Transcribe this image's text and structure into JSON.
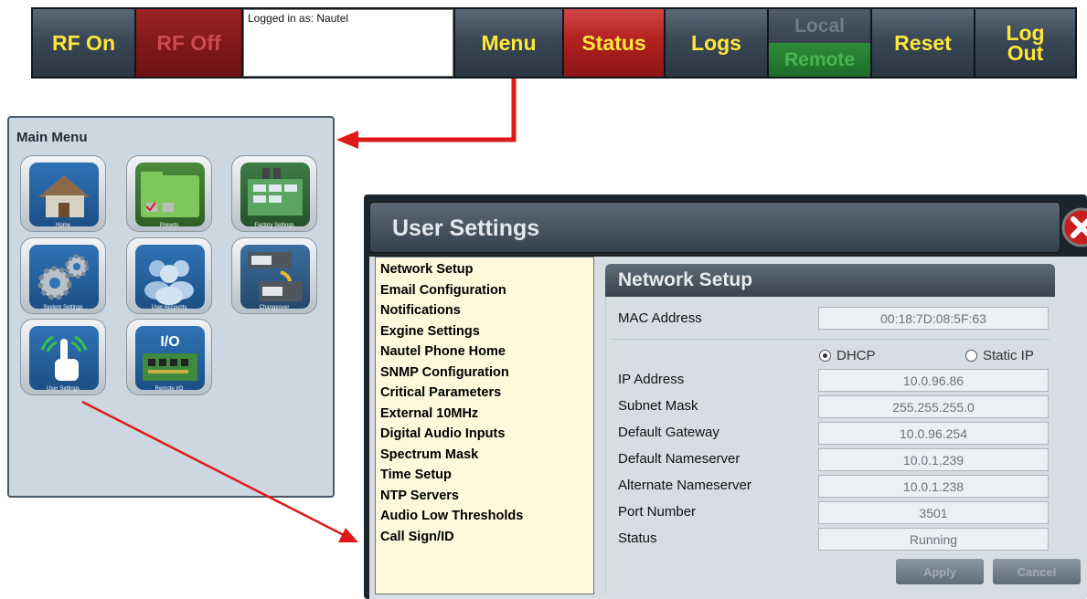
{
  "toolbar": {
    "rf_on": "RF On",
    "rf_off": "RF Off",
    "login_text": "Logged in as: Nautel",
    "menu": "Menu",
    "status": "Status",
    "logs": "Logs",
    "local": "Local",
    "remote": "Remote",
    "reset": "Reset",
    "logout_line1": "Log",
    "logout_line2": "Out"
  },
  "main_menu": {
    "title": "Main Menu",
    "items": [
      {
        "label": "Home",
        "icon": "home-icon"
      },
      {
        "label": "Presets",
        "icon": "presets-folder-icon"
      },
      {
        "label": "Factory Settings",
        "icon": "factory-icon"
      },
      {
        "label": "System Settings",
        "icon": "gears-icon"
      },
      {
        "label": "User Accounts",
        "icon": "users-icon"
      },
      {
        "label": "Changeover",
        "icon": "changeover-icon"
      },
      {
        "label": "User Settings",
        "icon": "touch-settings-icon"
      },
      {
        "label": "Remote I/O",
        "icon": "remote-io-icon"
      }
    ]
  },
  "user_settings": {
    "title": "User Settings",
    "menu_items": [
      "Network Setup",
      "Email Configuration",
      "Notifications",
      "Exgine Settings",
      "Nautel Phone Home",
      "SNMP Configuration",
      "Critical Parameters",
      "External 10MHz",
      "Digital Audio Inputs",
      "Spectrum Mask",
      "Time Setup",
      "NTP Servers",
      "Audio Low Thresholds",
      "Call Sign/ID"
    ],
    "network_setup": {
      "header": "Network Setup",
      "mac_label": "MAC Address",
      "mac_value": "00:18:7D:08:5F:63",
      "dhcp_label": "DHCP",
      "static_ip_label": "Static IP",
      "mode_selected": "DHCP",
      "fields": [
        {
          "label": "IP Address",
          "value": "10.0.96.86"
        },
        {
          "label": "Subnet Mask",
          "value": "255.255.255.0"
        },
        {
          "label": "Default Gateway",
          "value": "10.0.96.254"
        },
        {
          "label": "Default Nameserver",
          "value": "10.0.1.239"
        },
        {
          "label": "Alternate Nameserver",
          "value": "10.0.1.238"
        },
        {
          "label": "Port Number",
          "value": "3501"
        },
        {
          "label": "Status",
          "value": "Running"
        }
      ],
      "apply": "Apply",
      "cancel": "Cancel"
    }
  },
  "colors": {
    "toolbar_text": "#ffe63c",
    "arrow": "#e01818",
    "list_bg": "#fff8dc"
  }
}
